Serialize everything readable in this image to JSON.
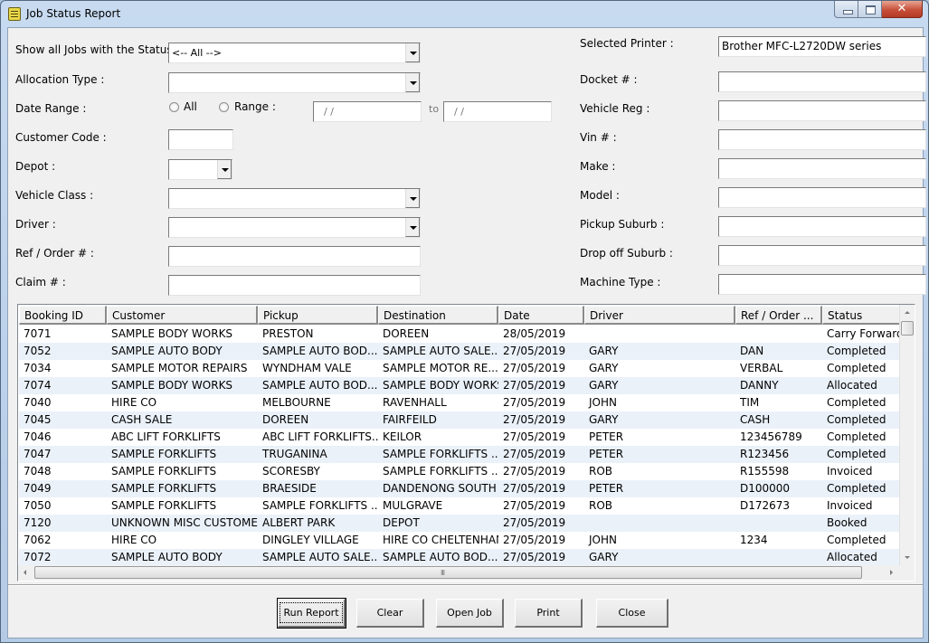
{
  "window": {
    "title": "Job Status Report",
    "controls": {
      "minimize": "minimize",
      "maximize": "maximize",
      "close": "✕"
    }
  },
  "filters_left": {
    "status": {
      "label": "Show all Jobs with the Status",
      "value": "<-- All -->"
    },
    "allocation_type": {
      "label": "Allocation Type :",
      "value": ""
    },
    "date_range": {
      "label": "Date Range :",
      "option_all": "All",
      "option_range": "Range :",
      "from": "/ /",
      "to_label": "to",
      "to": "/ /"
    },
    "customer_code": {
      "label": "Customer Code :",
      "value": ""
    },
    "depot": {
      "label": "Depot :",
      "value": ""
    },
    "vehicle_class": {
      "label": "Vehicle Class :",
      "value": ""
    },
    "driver": {
      "label": "Driver :",
      "value": ""
    },
    "ref_order": {
      "label": "Ref / Order # :",
      "value": ""
    },
    "claim": {
      "label": "Claim # :",
      "value": ""
    }
  },
  "filters_right": {
    "selected_printer": {
      "label": "Selected Printer :",
      "value": "Brother MFC-L2720DW series"
    },
    "docket": {
      "label": "Docket # :",
      "value": ""
    },
    "vehicle_reg": {
      "label": "Vehicle Reg :",
      "value": ""
    },
    "vin": {
      "label": "Vin # :",
      "value": ""
    },
    "make": {
      "label": "Make :",
      "value": ""
    },
    "model": {
      "label": "Model :",
      "value": ""
    },
    "pickup_suburb": {
      "label": "Pickup Suburb :",
      "value": ""
    },
    "dropoff_suburb": {
      "label": "Drop off Suburb :",
      "value": ""
    },
    "machine_type": {
      "label": "Machine Type :",
      "value": ""
    }
  },
  "table": {
    "columns": [
      "Booking ID",
      "Customer",
      "Pickup",
      "Destination",
      "Date",
      "Driver",
      "Ref / Order ...",
      "Status"
    ],
    "rows": [
      [
        "7071",
        "SAMPLE BODY WORKS",
        "PRESTON",
        "DOREEN",
        "28/05/2019",
        "",
        "",
        "Carry Forward"
      ],
      [
        "7052",
        "SAMPLE AUTO BODY",
        "SAMPLE AUTO BOD...",
        "SAMPLE AUTO SALE...",
        "27/05/2019",
        "GARY",
        "DAN",
        "Completed"
      ],
      [
        "7034",
        "SAMPLE MOTOR REPAIRS",
        "WYNDHAM VALE",
        "SAMPLE MOTOR RE...",
        "27/05/2019",
        "GARY",
        "VERBAL",
        "Completed"
      ],
      [
        "7074",
        "SAMPLE BODY WORKS",
        "SAMPLE AUTO BOD...",
        "SAMPLE BODY WORKS",
        "27/05/2019",
        "GARY",
        "DANNY",
        "Allocated"
      ],
      [
        "7040",
        "HIRE CO",
        "MELBOURNE",
        "RAVENHALL",
        "27/05/2019",
        "JOHN",
        "TIM",
        "Completed"
      ],
      [
        "7045",
        "CASH SALE",
        "DOREEN",
        "FAIRFEILD",
        "27/05/2019",
        "GARY",
        "CASH",
        "Completed"
      ],
      [
        "7046",
        "ABC LIFT FORKLIFTS",
        "ABC LIFT FORKLIFTS...",
        "KEILOR",
        "27/05/2019",
        "PETER",
        "123456789",
        "Completed"
      ],
      [
        "7047",
        "SAMPLE FORKLIFTS",
        "TRUGANINA",
        "SAMPLE FORKLIFTS ...",
        "27/05/2019",
        "PETER",
        "R123456",
        "Completed"
      ],
      [
        "7048",
        "SAMPLE FORKLIFTS",
        "SCORESBY",
        "SAMPLE FORKLIFTS ...",
        "27/05/2019",
        "ROB",
        "R155598",
        "Invoiced"
      ],
      [
        "7049",
        "SAMPLE FORKLIFTS",
        "BRAESIDE",
        "DANDENONG SOUTH",
        "27/05/2019",
        "PETER",
        "D100000",
        "Completed"
      ],
      [
        "7050",
        "SAMPLE FORKLIFTS",
        "SAMPLE FORKLIFTS ...",
        "MULGRAVE",
        "27/05/2019",
        "ROB",
        "D172673",
        "Invoiced"
      ],
      [
        "7120",
        "UNKNOWN MISC CUSTOMER",
        "ALBERT PARK",
        "DEPOT",
        "27/05/2019",
        "",
        "",
        "Booked"
      ],
      [
        "7062",
        "HIRE CO",
        "DINGLEY VILLAGE",
        "HIRE CO CHELTENHAM",
        "27/05/2019",
        "JOHN",
        "1234",
        "Completed"
      ],
      [
        "7072",
        "SAMPLE AUTO BODY",
        "SAMPLE AUTO SALE...",
        "SAMPLE AUTO BOD...",
        "27/05/2019",
        "GARY",
        "",
        "Allocated"
      ]
    ]
  },
  "buttons": {
    "run_report": "Run Report",
    "clear": "Clear",
    "open_job": "Open Job",
    "print": "Print",
    "close": "Close"
  },
  "colors": {
    "row_alt": "#eaf1f9",
    "client_bg": "#f0f0f0",
    "close_button": "#c7503a"
  }
}
